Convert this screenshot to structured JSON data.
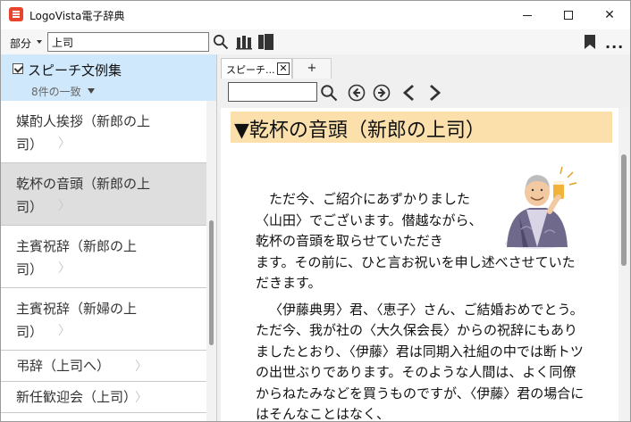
{
  "window": {
    "title": "LogoVista電子辞典",
    "controls": {
      "minimize": "minimize",
      "maximize": "maximize",
      "close": "✕"
    }
  },
  "toolbar": {
    "scope_label": "部分",
    "search_value": "上司",
    "icons": [
      "search-icon",
      "books-icon",
      "panels-icon",
      "bookmark-icon",
      "more-icon"
    ],
    "more_label": "..."
  },
  "sidebar": {
    "dictionary_name": "スピーチ文例集",
    "match_count": "8件の一致",
    "dictionary_checked": true,
    "items": [
      {
        "line1": "媒酌人挨拶（新郎の上",
        "line2": "司）",
        "selected": false
      },
      {
        "line1": "乾杯の音頭（新郎の上",
        "line2": "司）",
        "selected": true
      },
      {
        "line1": "主賓祝辞（新郎の上",
        "line2": "司）",
        "selected": false
      },
      {
        "line1": "主賓祝辞（新婦の上",
        "line2": "司）",
        "selected": false
      },
      {
        "line1": "弔辞（上司へ）",
        "line2": "",
        "selected": false
      },
      {
        "line1": "新任歓迎会（上司）",
        "line2": "",
        "selected": false
      }
    ],
    "chevron": "〉"
  },
  "tabs": {
    "active_label": "スピーチ...",
    "close_label": "✕",
    "add_label": "+"
  },
  "content": {
    "heading": "▼乾杯の音頭（新郎の上司）",
    "paragraph1_narrow": "ただ今、ご紹介にあずかりました〈山田〉でございます。僣越ながら、乾杯の音頭を取らせていただき",
    "paragraph1_rest": "ます。その前に、ひと言お祝いを申し述べさせていただきます。",
    "paragraph2": "〈伊藤典男〉君、〈恵子〉さん、ご結婚おめでとう。ただ今、我が社の〈大久保会長〉からの祝辞にもありましたとおり、〈伊藤〉君は同期入社組の中では断トツの出世ぶりであります。そのような人間は、よく同僚からねたみなどを買うものですが、〈伊藤〉君の場合にはそんなことはなく、"
  },
  "colors": {
    "accent_header": "#cfe8fb",
    "heading_highlight": "#fbe0ac",
    "selected_item": "#dedede",
    "app_icon": "#e8452c"
  }
}
